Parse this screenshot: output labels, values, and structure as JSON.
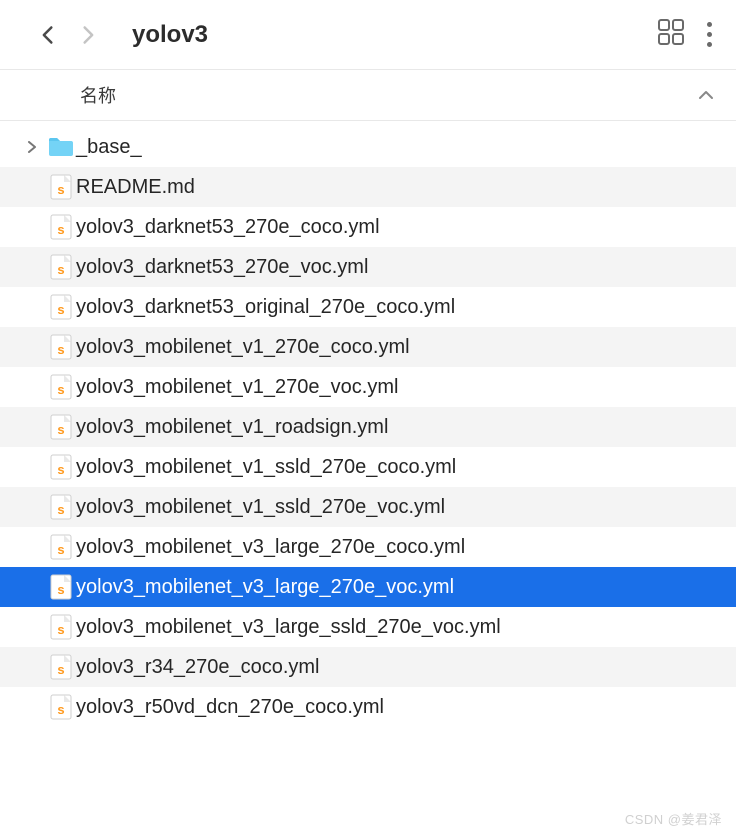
{
  "toolbar": {
    "title": "yolov3"
  },
  "columns": {
    "name_header": "名称"
  },
  "items": [
    {
      "kind": "folder",
      "name": "_base_",
      "expandable": true
    },
    {
      "kind": "file",
      "name": "README.md"
    },
    {
      "kind": "file",
      "name": "yolov3_darknet53_270e_coco.yml"
    },
    {
      "kind": "file",
      "name": "yolov3_darknet53_270e_voc.yml"
    },
    {
      "kind": "file",
      "name": "yolov3_darknet53_original_270e_coco.yml"
    },
    {
      "kind": "file",
      "name": "yolov3_mobilenet_v1_270e_coco.yml"
    },
    {
      "kind": "file",
      "name": "yolov3_mobilenet_v1_270e_voc.yml"
    },
    {
      "kind": "file",
      "name": "yolov3_mobilenet_v1_roadsign.yml"
    },
    {
      "kind": "file",
      "name": "yolov3_mobilenet_v1_ssld_270e_coco.yml"
    },
    {
      "kind": "file",
      "name": "yolov3_mobilenet_v1_ssld_270e_voc.yml"
    },
    {
      "kind": "file",
      "name": "yolov3_mobilenet_v3_large_270e_coco.yml"
    },
    {
      "kind": "file",
      "name": "yolov3_mobilenet_v3_large_270e_voc.yml",
      "selected": true
    },
    {
      "kind": "file",
      "name": "yolov3_mobilenet_v3_large_ssld_270e_voc.yml"
    },
    {
      "kind": "file",
      "name": "yolov3_r34_270e_coco.yml"
    },
    {
      "kind": "file",
      "name": "yolov3_r50vd_dcn_270e_coco.yml"
    }
  ],
  "watermark": "CSDN @姜君泽"
}
